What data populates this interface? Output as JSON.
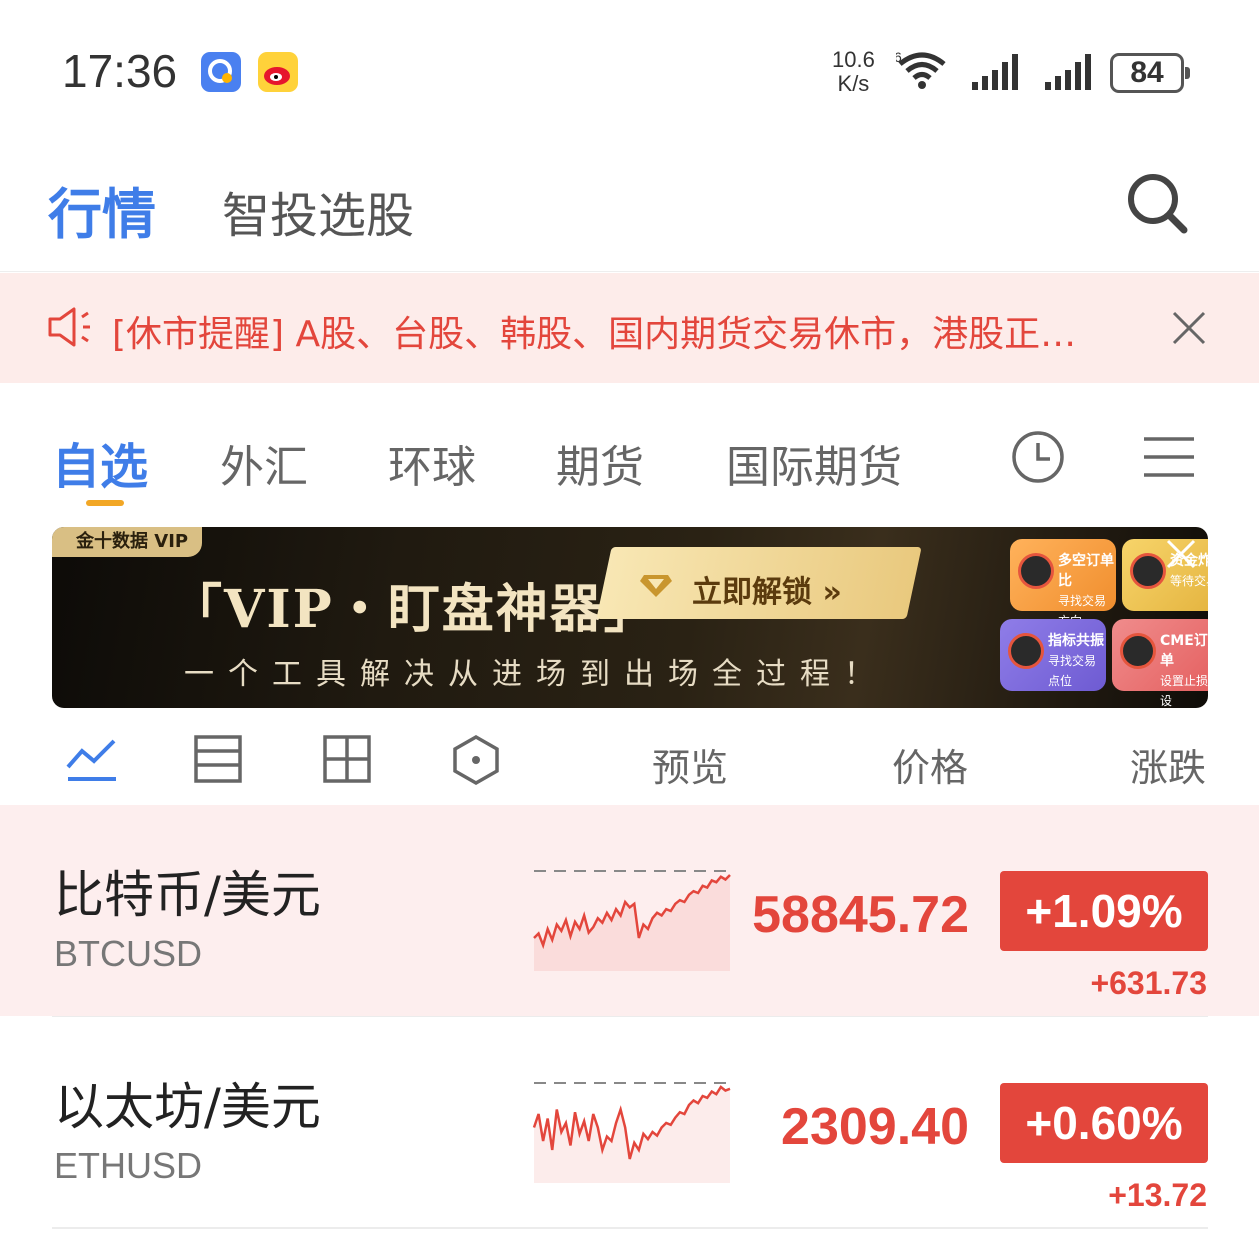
{
  "status_bar": {
    "time": "17:36",
    "net_speed_value": "10.6",
    "net_speed_unit": "K/s",
    "battery": "84",
    "icons": [
      "qq-browser-icon",
      "weibo-icon",
      "wifi-icon",
      "signal-icon",
      "signal-icon",
      "battery-icon"
    ]
  },
  "header": {
    "tab_active": "行情",
    "tab_other": "智投选股",
    "search_icon": "search-icon"
  },
  "notice": {
    "text": "[休市提醒] A股、台股、韩股、国内期货交易休市，港股正…",
    "colors": {
      "text": "#e3463c",
      "background": "#fdecea"
    }
  },
  "categories": {
    "items": [
      "自选",
      "外汇",
      "环球",
      "期货",
      "国际期货"
    ],
    "active_index": 0,
    "icons": [
      "clock-icon",
      "menu-icon"
    ],
    "accent": "#3f7de8",
    "underline_color": "#f2a726"
  },
  "banner": {
    "badge": "金十数据 VIP",
    "title": "「VIP・盯盘神器」",
    "subtitle": "一个工具解决从进场到出场全过程！",
    "cta": "立即解锁 »",
    "tiles": [
      {
        "title": "多空订单比",
        "sub": "寻找交易方向"
      },
      {
        "title": "资金炸",
        "sub": "等待交易"
      },
      {
        "title": "指标共振",
        "sub": "寻找交易点位"
      },
      {
        "title": "CME订单",
        "sub": "设置止损设"
      }
    ]
  },
  "columns": {
    "view_icons": [
      "line-chart-icon",
      "split-view-icon",
      "grid-view-icon",
      "hexagon-view-icon"
    ],
    "preview": "预览",
    "price": "价格",
    "change": "涨跌"
  },
  "rows": [
    {
      "name": "比特币/美元",
      "code": "BTCUSD",
      "price": "58845.72",
      "pct": "+1.09%",
      "change": "+631.73",
      "highlighted": true,
      "spark": [
        0.3,
        0.35,
        0.22,
        0.4,
        0.28,
        0.45,
        0.38,
        0.5,
        0.32,
        0.48,
        0.4,
        0.55,
        0.36,
        0.42,
        0.52,
        0.47,
        0.58,
        0.5,
        0.62,
        0.55,
        0.7,
        0.64,
        0.68,
        0.3,
        0.45,
        0.4,
        0.52,
        0.58,
        0.55,
        0.62,
        0.6,
        0.68,
        0.72,
        0.7,
        0.78,
        0.82,
        0.8,
        0.88,
        0.86,
        0.94,
        0.92,
        0.98,
        0.95,
        1.0
      ]
    },
    {
      "name": "以太坊/美元",
      "code": "ETHUSD",
      "price": "2309.40",
      "pct": "+0.60%",
      "change": "+13.72",
      "highlighted": false,
      "spark": [
        0.55,
        0.7,
        0.4,
        0.65,
        0.3,
        0.75,
        0.5,
        0.6,
        0.35,
        0.72,
        0.48,
        0.62,
        0.4,
        0.7,
        0.55,
        0.3,
        0.45,
        0.4,
        0.6,
        0.75,
        0.55,
        0.2,
        0.38,
        0.3,
        0.48,
        0.42,
        0.5,
        0.46,
        0.55,
        0.6,
        0.58,
        0.66,
        0.72,
        0.7,
        0.8,
        0.85,
        0.82,
        0.9,
        0.88,
        0.95,
        0.92,
        1.0,
        0.96,
        0.98
      ]
    }
  ],
  "colors": {
    "up": "#e3463c",
    "highlight_row": "#fdeeee"
  }
}
